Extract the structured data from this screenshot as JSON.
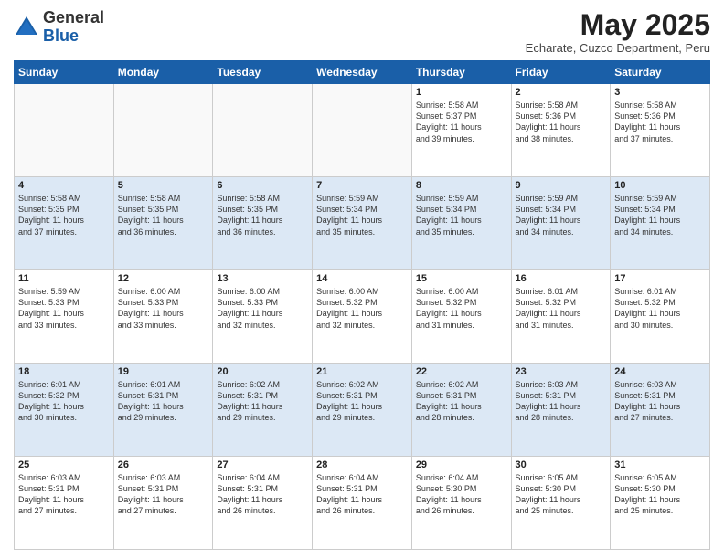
{
  "header": {
    "logo_general": "General",
    "logo_blue": "Blue",
    "month_title": "May 2025",
    "subtitle": "Echarate, Cuzco Department, Peru"
  },
  "days_of_week": [
    "Sunday",
    "Monday",
    "Tuesday",
    "Wednesday",
    "Thursday",
    "Friday",
    "Saturday"
  ],
  "weeks": [
    [
      {
        "day": "",
        "info": ""
      },
      {
        "day": "",
        "info": ""
      },
      {
        "day": "",
        "info": ""
      },
      {
        "day": "",
        "info": ""
      },
      {
        "day": "1",
        "info": "Sunrise: 5:58 AM\nSunset: 5:37 PM\nDaylight: 11 hours\nand 39 minutes."
      },
      {
        "day": "2",
        "info": "Sunrise: 5:58 AM\nSunset: 5:36 PM\nDaylight: 11 hours\nand 38 minutes."
      },
      {
        "day": "3",
        "info": "Sunrise: 5:58 AM\nSunset: 5:36 PM\nDaylight: 11 hours\nand 37 minutes."
      }
    ],
    [
      {
        "day": "4",
        "info": "Sunrise: 5:58 AM\nSunset: 5:35 PM\nDaylight: 11 hours\nand 37 minutes."
      },
      {
        "day": "5",
        "info": "Sunrise: 5:58 AM\nSunset: 5:35 PM\nDaylight: 11 hours\nand 36 minutes."
      },
      {
        "day": "6",
        "info": "Sunrise: 5:58 AM\nSunset: 5:35 PM\nDaylight: 11 hours\nand 36 minutes."
      },
      {
        "day": "7",
        "info": "Sunrise: 5:59 AM\nSunset: 5:34 PM\nDaylight: 11 hours\nand 35 minutes."
      },
      {
        "day": "8",
        "info": "Sunrise: 5:59 AM\nSunset: 5:34 PM\nDaylight: 11 hours\nand 35 minutes."
      },
      {
        "day": "9",
        "info": "Sunrise: 5:59 AM\nSunset: 5:34 PM\nDaylight: 11 hours\nand 34 minutes."
      },
      {
        "day": "10",
        "info": "Sunrise: 5:59 AM\nSunset: 5:34 PM\nDaylight: 11 hours\nand 34 minutes."
      }
    ],
    [
      {
        "day": "11",
        "info": "Sunrise: 5:59 AM\nSunset: 5:33 PM\nDaylight: 11 hours\nand 33 minutes."
      },
      {
        "day": "12",
        "info": "Sunrise: 6:00 AM\nSunset: 5:33 PM\nDaylight: 11 hours\nand 33 minutes."
      },
      {
        "day": "13",
        "info": "Sunrise: 6:00 AM\nSunset: 5:33 PM\nDaylight: 11 hours\nand 32 minutes."
      },
      {
        "day": "14",
        "info": "Sunrise: 6:00 AM\nSunset: 5:32 PM\nDaylight: 11 hours\nand 32 minutes."
      },
      {
        "day": "15",
        "info": "Sunrise: 6:00 AM\nSunset: 5:32 PM\nDaylight: 11 hours\nand 31 minutes."
      },
      {
        "day": "16",
        "info": "Sunrise: 6:01 AM\nSunset: 5:32 PM\nDaylight: 11 hours\nand 31 minutes."
      },
      {
        "day": "17",
        "info": "Sunrise: 6:01 AM\nSunset: 5:32 PM\nDaylight: 11 hours\nand 30 minutes."
      }
    ],
    [
      {
        "day": "18",
        "info": "Sunrise: 6:01 AM\nSunset: 5:32 PM\nDaylight: 11 hours\nand 30 minutes."
      },
      {
        "day": "19",
        "info": "Sunrise: 6:01 AM\nSunset: 5:31 PM\nDaylight: 11 hours\nand 29 minutes."
      },
      {
        "day": "20",
        "info": "Sunrise: 6:02 AM\nSunset: 5:31 PM\nDaylight: 11 hours\nand 29 minutes."
      },
      {
        "day": "21",
        "info": "Sunrise: 6:02 AM\nSunset: 5:31 PM\nDaylight: 11 hours\nand 29 minutes."
      },
      {
        "day": "22",
        "info": "Sunrise: 6:02 AM\nSunset: 5:31 PM\nDaylight: 11 hours\nand 28 minutes."
      },
      {
        "day": "23",
        "info": "Sunrise: 6:03 AM\nSunset: 5:31 PM\nDaylight: 11 hours\nand 28 minutes."
      },
      {
        "day": "24",
        "info": "Sunrise: 6:03 AM\nSunset: 5:31 PM\nDaylight: 11 hours\nand 27 minutes."
      }
    ],
    [
      {
        "day": "25",
        "info": "Sunrise: 6:03 AM\nSunset: 5:31 PM\nDaylight: 11 hours\nand 27 minutes."
      },
      {
        "day": "26",
        "info": "Sunrise: 6:03 AM\nSunset: 5:31 PM\nDaylight: 11 hours\nand 27 minutes."
      },
      {
        "day": "27",
        "info": "Sunrise: 6:04 AM\nSunset: 5:31 PM\nDaylight: 11 hours\nand 26 minutes."
      },
      {
        "day": "28",
        "info": "Sunrise: 6:04 AM\nSunset: 5:31 PM\nDaylight: 11 hours\nand 26 minutes."
      },
      {
        "day": "29",
        "info": "Sunrise: 6:04 AM\nSunset: 5:30 PM\nDaylight: 11 hours\nand 26 minutes."
      },
      {
        "day": "30",
        "info": "Sunrise: 6:05 AM\nSunset: 5:30 PM\nDaylight: 11 hours\nand 25 minutes."
      },
      {
        "day": "31",
        "info": "Sunrise: 6:05 AM\nSunset: 5:30 PM\nDaylight: 11 hours\nand 25 minutes."
      }
    ]
  ]
}
